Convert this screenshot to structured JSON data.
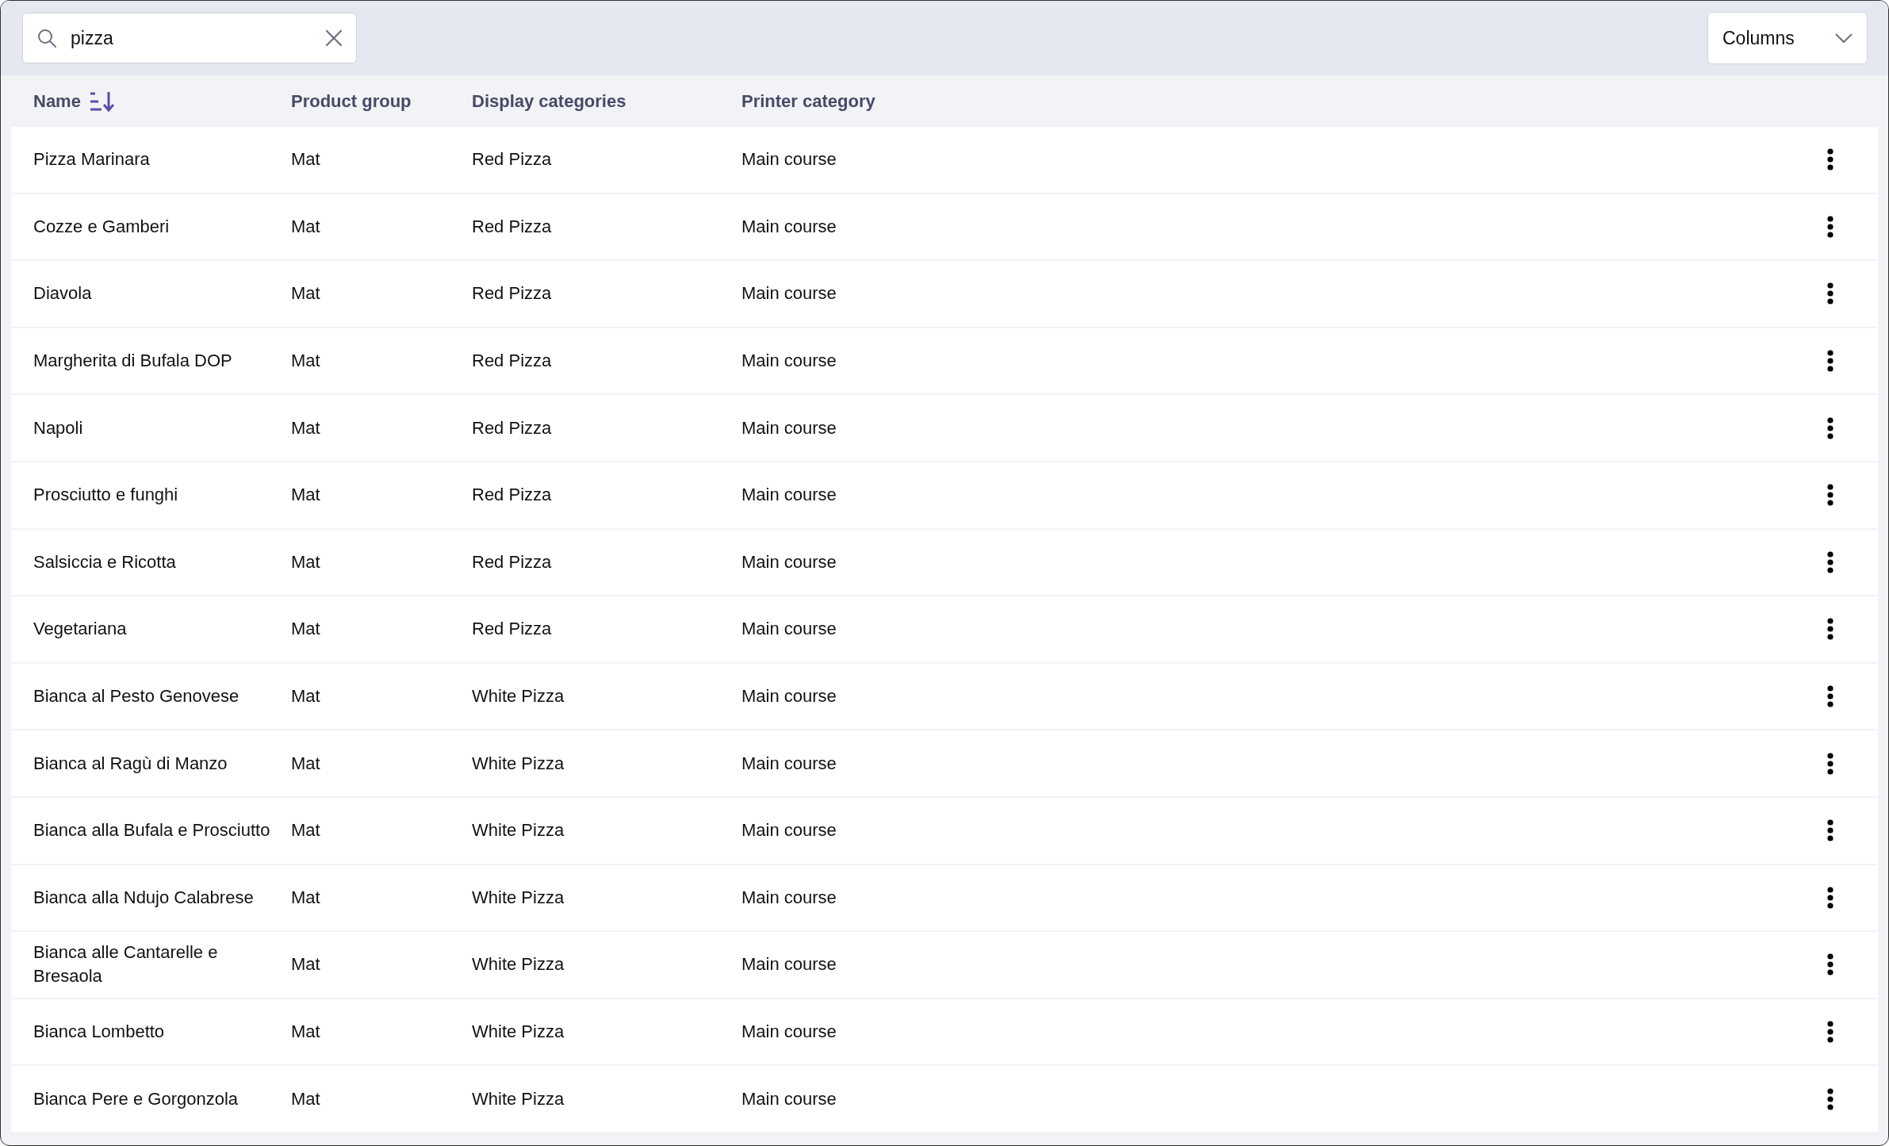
{
  "search": {
    "value": "pizza"
  },
  "columns_button": {
    "label": "Columns"
  },
  "table": {
    "columns": [
      {
        "label": "Name",
        "sorted": true
      },
      {
        "label": "Product group",
        "sorted": false
      },
      {
        "label": "Display categories",
        "sorted": false
      },
      {
        "label": "Printer category",
        "sorted": false
      }
    ],
    "rows": [
      {
        "name": "Pizza Marinara",
        "product_group": "Mat",
        "display_categories": "Red Pizza",
        "printer_category": "Main course"
      },
      {
        "name": "Cozze e Gamberi",
        "product_group": "Mat",
        "display_categories": "Red Pizza",
        "printer_category": "Main course"
      },
      {
        "name": "Diavola",
        "product_group": "Mat",
        "display_categories": "Red Pizza",
        "printer_category": "Main course"
      },
      {
        "name": "Margherita di Bufala DOP",
        "product_group": "Mat",
        "display_categories": "Red Pizza",
        "printer_category": "Main course"
      },
      {
        "name": "Napoli",
        "product_group": "Mat",
        "display_categories": "Red Pizza",
        "printer_category": "Main course"
      },
      {
        "name": "Prosciutto e funghi",
        "product_group": "Mat",
        "display_categories": "Red Pizza",
        "printer_category": "Main course"
      },
      {
        "name": "Salsiccia e Ricotta",
        "product_group": "Mat",
        "display_categories": "Red Pizza",
        "printer_category": "Main course"
      },
      {
        "name": "Vegetariana",
        "product_group": "Mat",
        "display_categories": "Red Pizza",
        "printer_category": "Main course"
      },
      {
        "name": "Bianca al Pesto Genovese",
        "product_group": "Mat",
        "display_categories": "White Pizza",
        "printer_category": "Main course"
      },
      {
        "name": "Bianca al Ragù di Manzo",
        "product_group": "Mat",
        "display_categories": "White Pizza",
        "printer_category": "Main course"
      },
      {
        "name": "Bianca alla Bufala e Prosciutto",
        "product_group": "Mat",
        "display_categories": "White Pizza",
        "printer_category": "Main course"
      },
      {
        "name": "Bianca alla Ndujo Calabrese",
        "product_group": "Mat",
        "display_categories": "White Pizza",
        "printer_category": "Main course"
      },
      {
        "name": "Bianca alle Cantarelle e Bresaola",
        "product_group": "Mat",
        "display_categories": "White Pizza",
        "printer_category": "Main course"
      },
      {
        "name": "Bianca Lombetto",
        "product_group": "Mat",
        "display_categories": "White Pizza",
        "printer_category": "Main course"
      },
      {
        "name": "Bianca Pere e Gorgonzola",
        "product_group": "Mat",
        "display_categories": "White Pizza",
        "printer_category": "Main course"
      }
    ]
  }
}
